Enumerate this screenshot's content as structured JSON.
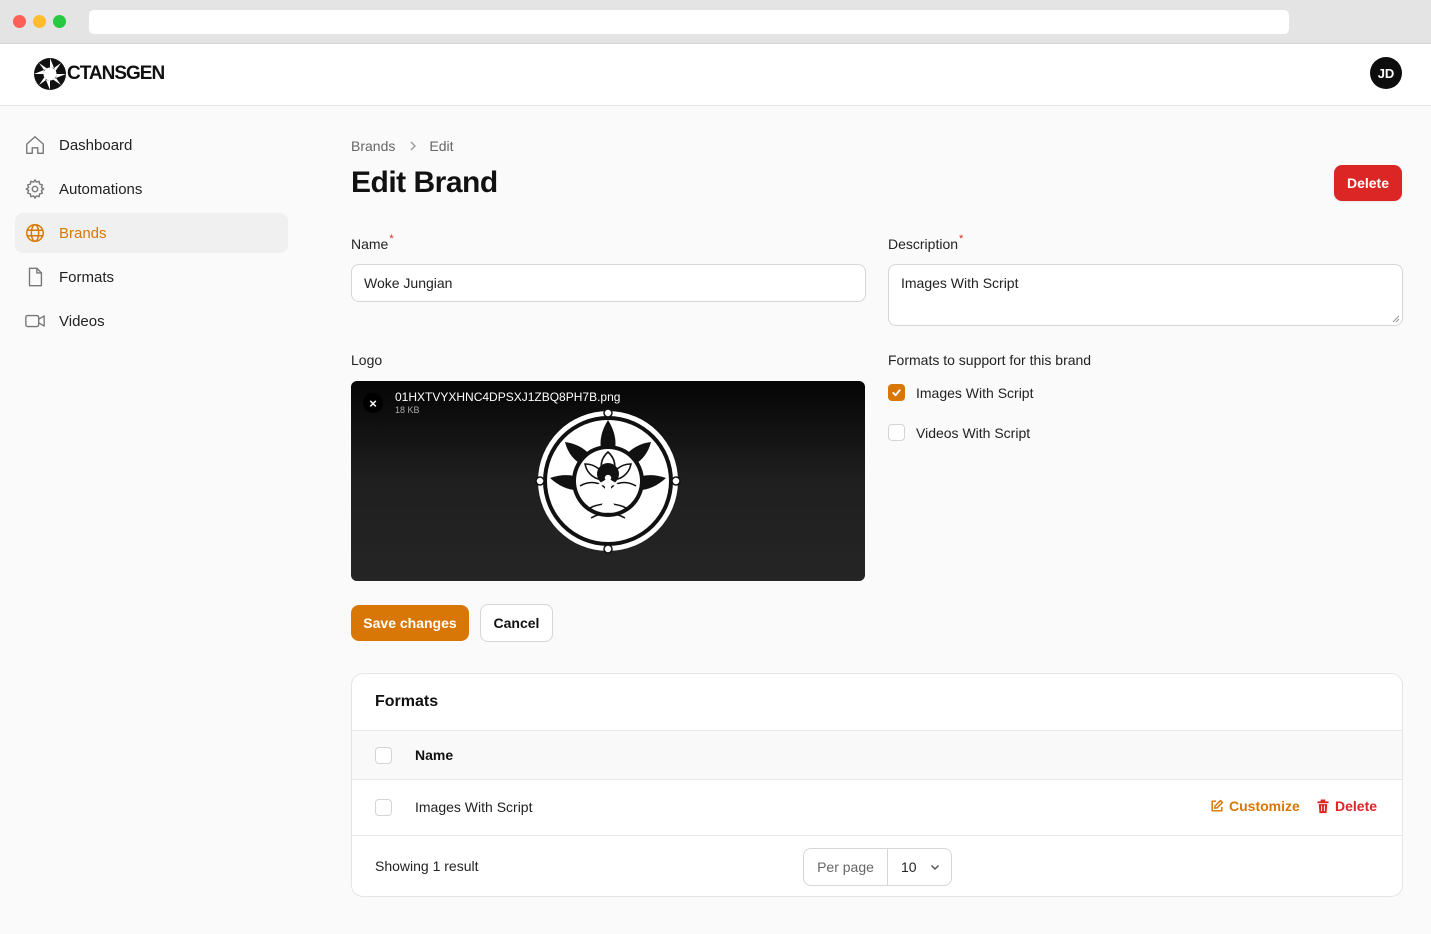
{
  "app": {
    "brand_name": "CTANSGEN",
    "user_initials": "JD"
  },
  "colors": {
    "accent": "#d97706",
    "danger": "#dc2626"
  },
  "sidebar": {
    "items": [
      {
        "label": "Dashboard",
        "icon": "home-icon",
        "active": false
      },
      {
        "label": "Automations",
        "icon": "gear-icon",
        "active": false
      },
      {
        "label": "Brands",
        "icon": "globe-icon",
        "active": true
      },
      {
        "label": "Formats",
        "icon": "document-icon",
        "active": false
      },
      {
        "label": "Videos",
        "icon": "video-camera-icon",
        "active": false
      }
    ]
  },
  "breadcrumb": {
    "first": "Brands",
    "second": "Edit"
  },
  "page": {
    "title": "Edit Brand",
    "delete_label": "Delete"
  },
  "form": {
    "name_label": "Name",
    "name_value": "Woke Jungian",
    "description_label": "Description",
    "description_value": "Images With Script",
    "required_mark": "*",
    "logo_label": "Logo",
    "logo_file_name": "01HXTVYXHNC4DPSXJ1ZBQ8PH7B.png",
    "logo_file_size": "18 KB",
    "logo_remove": "×",
    "formats_label": "Formats to support for this brand",
    "format_options": [
      {
        "label": "Images With Script",
        "checked": true
      },
      {
        "label": "Videos With Script",
        "checked": false
      }
    ],
    "save_label": "Save changes",
    "cancel_label": "Cancel"
  },
  "formats_table": {
    "title": "Formats",
    "column_name": "Name",
    "rows": [
      {
        "name": "Images With Script",
        "customize_label": "Customize",
        "delete_label": "Delete"
      }
    ],
    "footer": {
      "showing": "Showing 1 result",
      "per_page_label": "Per page",
      "per_page_value": "10"
    }
  }
}
